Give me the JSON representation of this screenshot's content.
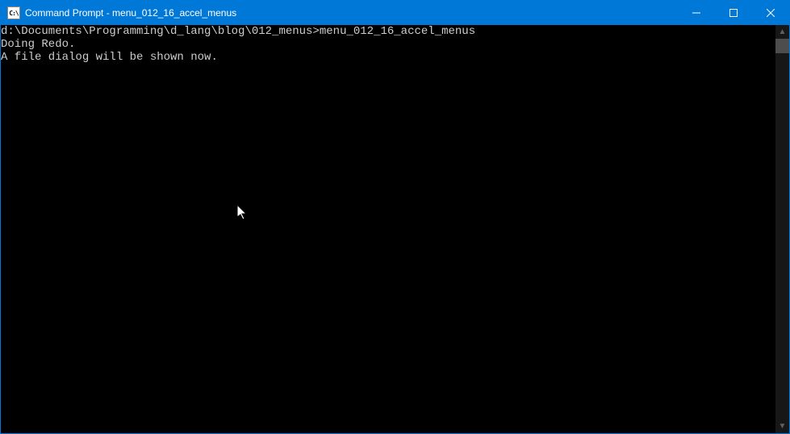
{
  "titlebar": {
    "icon_label": "C:\\",
    "title": "Command Prompt - menu_012_16_accel_menus",
    "minimize_name": "minimize",
    "maximize_name": "maximize",
    "close_name": "close"
  },
  "console": {
    "lines": [
      "",
      "d:\\Documents\\Programming\\d_lang\\blog\\012_menus>menu_012_16_accel_menus",
      "Doing Redo.",
      "A file dialog will be shown now."
    ]
  },
  "scrollbar": {
    "up_glyph": "▲",
    "down_glyph": "▼"
  }
}
